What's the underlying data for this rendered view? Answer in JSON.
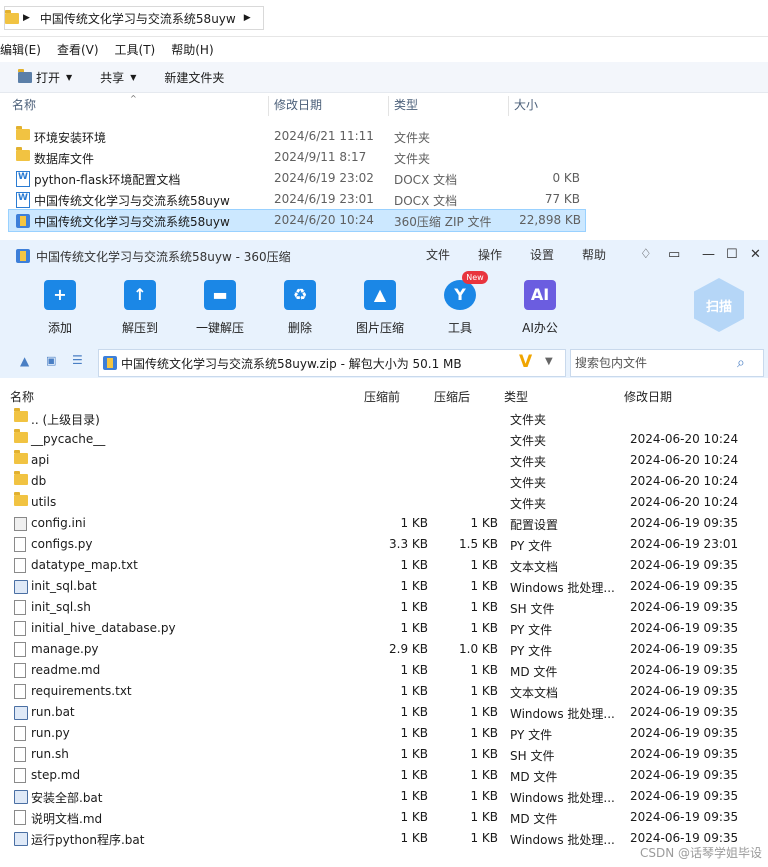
{
  "explorer": {
    "breadcrumb": "中国传统文化学习与交流系统58uyw",
    "menu": [
      "编辑(E)",
      "查看(V)",
      "工具(T)",
      "帮助(H)"
    ],
    "commands": {
      "open": "打开",
      "share": "共享",
      "new_folder": "新建文件夹"
    },
    "columns": {
      "name": "名称",
      "modified": "修改日期",
      "type": "类型",
      "size": "大小"
    },
    "rows": [
      {
        "name": "环境安装环境",
        "modified": "2024/6/21 11:11",
        "type": "文件夹",
        "size": "",
        "icon": "folder-icon"
      },
      {
        "name": "数据库文件",
        "modified": "2024/9/11 8:17",
        "type": "文件夹",
        "size": "",
        "icon": "folder-icon"
      },
      {
        "name": "python-flask环境配置文档",
        "modified": "2024/6/19 23:02",
        "type": "DOCX 文档",
        "size": "0 KB",
        "icon": "word-doc-icon"
      },
      {
        "name": "中国传统文化学习与交流系统58uyw",
        "modified": "2024/6/19 23:01",
        "type": "DOCX 文档",
        "size": "77 KB",
        "icon": "word-doc-icon"
      },
      {
        "name": "中国传统文化学习与交流系统58uyw",
        "modified": "2024/6/20 10:24",
        "type": "360压缩 ZIP 文件",
        "size": "22,898 KB",
        "icon": "zip-icon",
        "selected": true
      }
    ]
  },
  "zip": {
    "title": "中国传统文化学习与交流系统58uyw - 360压缩",
    "menu": [
      "文件",
      "操作",
      "设置",
      "帮助"
    ],
    "toolbar": [
      "添加",
      "解压到",
      "一键解压",
      "删除",
      "图片压缩",
      "工具",
      "AI办公"
    ],
    "new_badge": "New",
    "scan_label": "扫描",
    "path": "中国传统文化学习与交流系统58uyw.zip - 解包大小为 50.1 MB",
    "search_placeholder": "搜索包内文件",
    "columns": {
      "name": "名称",
      "before": "压缩前",
      "after": "压缩后",
      "type": "类型",
      "modified": "修改日期"
    },
    "rows": [
      {
        "name": ".. (上级目录)",
        "before": "",
        "after": "",
        "type": "文件夹",
        "modified": "",
        "icon": "folder"
      },
      {
        "name": "__pycache__",
        "before": "",
        "after": "",
        "type": "文件夹",
        "modified": "2024-06-20 10:24",
        "icon": "folder"
      },
      {
        "name": "api",
        "before": "",
        "after": "",
        "type": "文件夹",
        "modified": "2024-06-20 10:24",
        "icon": "folder"
      },
      {
        "name": "db",
        "before": "",
        "after": "",
        "type": "文件夹",
        "modified": "2024-06-20 10:24",
        "icon": "folder"
      },
      {
        "name": "utils",
        "before": "",
        "after": "",
        "type": "文件夹",
        "modified": "2024-06-20 10:24",
        "icon": "folder"
      },
      {
        "name": "config.ini",
        "before": "1 KB",
        "after": "1 KB",
        "type": "配置设置",
        "modified": "2024-06-19 09:35",
        "icon": "config"
      },
      {
        "name": "configs.py",
        "before": "3.3 KB",
        "after": "1.5 KB",
        "type": "PY 文件",
        "modified": "2024-06-19 23:01",
        "icon": "file"
      },
      {
        "name": "datatype_map.txt",
        "before": "1 KB",
        "after": "1 KB",
        "type": "文本文档",
        "modified": "2024-06-19 09:35",
        "icon": "file"
      },
      {
        "name": "init_sql.bat",
        "before": "1 KB",
        "after": "1 KB",
        "type": "Windows 批处理...",
        "modified": "2024-06-19 09:35",
        "icon": "bat"
      },
      {
        "name": "init_sql.sh",
        "before": "1 KB",
        "after": "1 KB",
        "type": "SH 文件",
        "modified": "2024-06-19 09:35",
        "icon": "file"
      },
      {
        "name": "initial_hive_database.py",
        "before": "1 KB",
        "after": "1 KB",
        "type": "PY 文件",
        "modified": "2024-06-19 09:35",
        "icon": "file"
      },
      {
        "name": "manage.py",
        "before": "2.9 KB",
        "after": "1.0 KB",
        "type": "PY 文件",
        "modified": "2024-06-19 09:35",
        "icon": "file"
      },
      {
        "name": "readme.md",
        "before": "1 KB",
        "after": "1 KB",
        "type": "MD 文件",
        "modified": "2024-06-19 09:35",
        "icon": "file"
      },
      {
        "name": "requirements.txt",
        "before": "1 KB",
        "after": "1 KB",
        "type": "文本文档",
        "modified": "2024-06-19 09:35",
        "icon": "file"
      },
      {
        "name": "run.bat",
        "before": "1 KB",
        "after": "1 KB",
        "type": "Windows 批处理...",
        "modified": "2024-06-19 09:35",
        "icon": "bat"
      },
      {
        "name": "run.py",
        "before": "1 KB",
        "after": "1 KB",
        "type": "PY 文件",
        "modified": "2024-06-19 09:35",
        "icon": "file"
      },
      {
        "name": "run.sh",
        "before": "1 KB",
        "after": "1 KB",
        "type": "SH 文件",
        "modified": "2024-06-19 09:35",
        "icon": "file"
      },
      {
        "name": "step.md",
        "before": "1 KB",
        "after": "1 KB",
        "type": "MD 文件",
        "modified": "2024-06-19 09:35",
        "icon": "file"
      },
      {
        "name": "安装全部.bat",
        "before": "1 KB",
        "after": "1 KB",
        "type": "Windows 批处理...",
        "modified": "2024-06-19 09:35",
        "icon": "bat"
      },
      {
        "name": "说明文档.md",
        "before": "1 KB",
        "after": "1 KB",
        "type": "MD 文件",
        "modified": "2024-06-19 09:35",
        "icon": "file"
      },
      {
        "name": "运行python程序.bat",
        "before": "1 KB",
        "after": "1 KB",
        "type": "Windows 批处理...",
        "modified": "2024-06-19 09:35",
        "icon": "bat"
      }
    ]
  },
  "watermark": "CSDN @话琴学姐毕设",
  "colors": {
    "selection": "#cce8ff",
    "toolbar_bg": "#e8f2fd",
    "accent": "#1b87e6"
  }
}
